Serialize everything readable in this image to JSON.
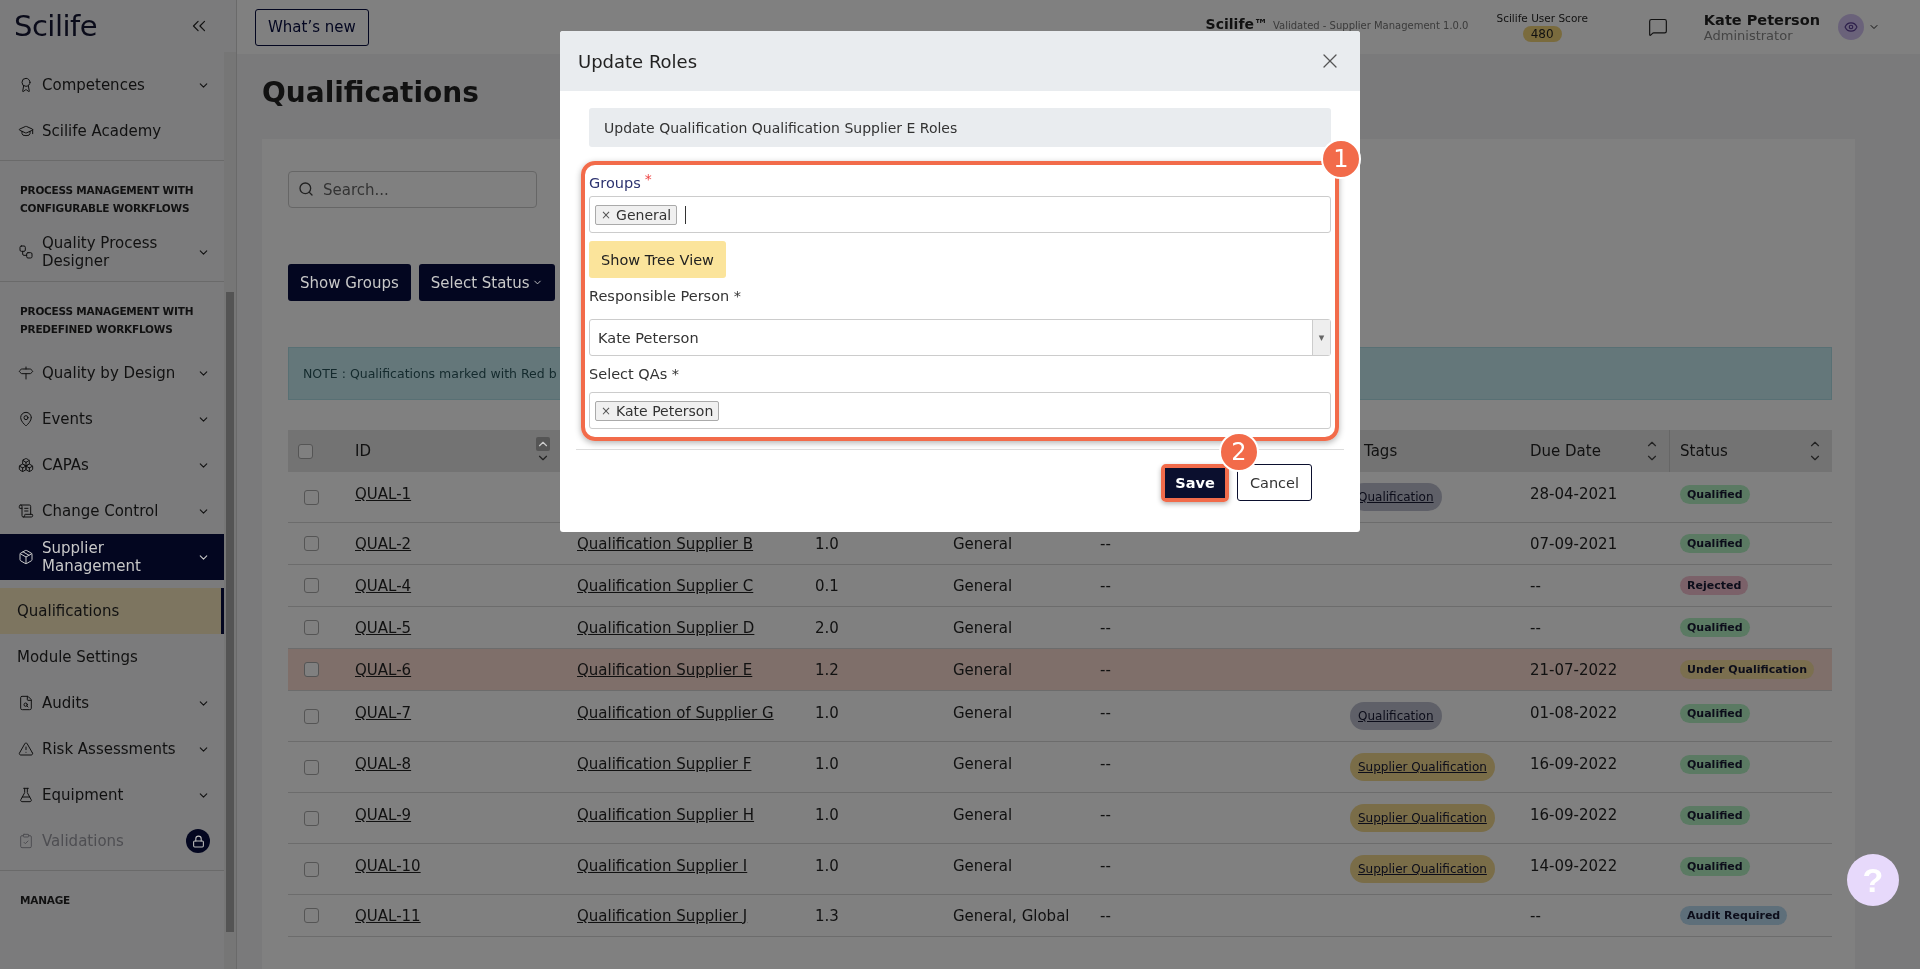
{
  "sidebar": {
    "logo": "Scilife",
    "items": [
      {
        "kind": "nav",
        "label": "Competences",
        "has_submenu": true,
        "selected": false,
        "locked": false
      },
      {
        "kind": "nav",
        "label": "Scilife Academy",
        "has_submenu": false,
        "selected": false,
        "locked": false
      },
      {
        "kind": "section",
        "label": "PROCESS MANAGEMENT WITH CONFIGURABLE WORKFLOWS"
      },
      {
        "kind": "nav",
        "label": "Quality Process Designer",
        "has_submenu": true,
        "selected": false,
        "locked": false
      },
      {
        "kind": "section",
        "label": "PROCESS MANAGEMENT WITH PREDEFINED WORKFLOWS"
      },
      {
        "kind": "nav",
        "label": "Quality by Design",
        "has_submenu": true,
        "selected": false,
        "locked": false
      },
      {
        "kind": "nav",
        "label": "Events",
        "has_submenu": true,
        "selected": false,
        "locked": false
      },
      {
        "kind": "nav",
        "label": "CAPAs",
        "has_submenu": true,
        "selected": false,
        "locked": false
      },
      {
        "kind": "nav",
        "label": "Change Control",
        "has_submenu": true,
        "selected": false,
        "locked": false
      },
      {
        "kind": "nav",
        "label": "Supplier Management",
        "has_submenu": true,
        "selected": true,
        "locked": false
      },
      {
        "kind": "sub",
        "label": "Qualifications",
        "selected": true
      },
      {
        "kind": "sub",
        "label": "Module Settings",
        "selected": false
      },
      {
        "kind": "nav",
        "label": "Audits",
        "has_submenu": true,
        "selected": false,
        "locked": false
      },
      {
        "kind": "nav",
        "label": "Risk Assessments",
        "has_submenu": true,
        "selected": false,
        "locked": false
      },
      {
        "kind": "nav",
        "label": "Equipment",
        "has_submenu": true,
        "selected": false,
        "locked": false
      },
      {
        "kind": "nav",
        "label": "Validations",
        "has_submenu": false,
        "selected": false,
        "locked": true
      },
      {
        "kind": "section",
        "label": "MANAGE"
      }
    ]
  },
  "topbar": {
    "whats_new": "What’s new",
    "app_name": "Scilife™",
    "app_version": "Validated - Supplier Management 1.0.0",
    "score_label": "Scilife User Score",
    "score": "480",
    "user_name": "Kate Peterson",
    "user_role": "Administrator"
  },
  "page": {
    "title": "Qualifications",
    "search": {
      "placeholder": "Search..."
    },
    "buttons": [
      "Show Groups",
      "Select Status"
    ],
    "note": "NOTE : Qualifications marked with Red b"
  },
  "table": {
    "all_checked": false,
    "columns": [
      {
        "label": "ID",
        "sortable": true,
        "sorted": true
      },
      {
        "label": "Tags",
        "sortable": false
      },
      {
        "label": "Due Date",
        "sortable": true,
        "sorted": false
      },
      {
        "label": "Status",
        "sortable": true,
        "sorted": false
      }
    ],
    "rows": [
      {
        "id": "QUAL-1",
        "tag": {
          "label": "Qualification",
          "color": "#5f6068"
        },
        "due": "28-04-2021",
        "status": {
          "label": "Qualified",
          "color": "#5b7a63"
        },
        "checked": false,
        "highlighted": false
      },
      {
        "id": "QUAL-2",
        "name": "Qualification Supplier B",
        "version": "1.0",
        "groups": "General",
        "column_6": "--",
        "due": "07-09-2021",
        "status": {
          "label": "Qualified",
          "color": "#5b7a63"
        },
        "checked": false,
        "highlighted": false
      },
      {
        "id": "QUAL-4",
        "name": "Qualification Supplier C",
        "version": "0.1",
        "groups": "General",
        "column_6": "--",
        "due": "--",
        "status": {
          "label": "Rejected",
          "color": "#7b6169"
        },
        "checked": false,
        "highlighted": false
      },
      {
        "id": "QUAL-5",
        "name": "Qualification Supplier D",
        "version": "2.0",
        "groups": "General",
        "column_6": "--",
        "due": "--",
        "status": {
          "label": "Qualified",
          "color": "#5b7a63"
        },
        "checked": false,
        "highlighted": false
      },
      {
        "id": "QUAL-6",
        "name": "Qualification Supplier E",
        "version": "1.2",
        "groups": "General",
        "column_6": "--",
        "due": "21-07-2022",
        "status": {
          "label": "Under Qualification",
          "color": "#7b6f4f"
        },
        "checked": false,
        "highlighted": true
      },
      {
        "id": "QUAL-7",
        "name": "Qualification of Supplier G",
        "version": "1.0",
        "groups": "General",
        "column_6": "--",
        "tag": {
          "label": "Qualification",
          "color": "#5f6068"
        },
        "due": "01-08-2022",
        "status": {
          "label": "Qualified",
          "color": "#5b7a63"
        },
        "checked": false,
        "highlighted": false
      },
      {
        "id": "QUAL-8",
        "name": "Qualification Supplier F",
        "version": "1.0",
        "groups": "General",
        "column_6": "--",
        "tag": {
          "label": "Supplier Qualification",
          "color": "#7a6d48"
        },
        "due": "16-09-2022",
        "status": {
          "label": "Qualified",
          "color": "#5b7a63"
        },
        "checked": false,
        "highlighted": false
      },
      {
        "id": "QUAL-9",
        "name": "Qualification Supplier H",
        "version": "1.0",
        "groups": "General",
        "column_6": "--",
        "tag": {
          "label": "Supplier Qualification",
          "color": "#7a6d48"
        },
        "due": "16-09-2022",
        "status": {
          "label": "Qualified",
          "color": "#5b7a63"
        },
        "checked": false,
        "highlighted": false
      },
      {
        "id": "QUAL-10",
        "name": "Qualification Supplier I",
        "version": "1.0",
        "groups": "General",
        "column_6": "--",
        "tag": {
          "label": "Supplier Qualification",
          "color": "#7a6d48"
        },
        "due": "14-09-2022",
        "status": {
          "label": "Qualified",
          "color": "#5b7a63"
        },
        "checked": false,
        "highlighted": false
      },
      {
        "id": "QUAL-11",
        "name": "Qualification Supplier J",
        "version": "1.3",
        "groups": "General, Global",
        "column_6": "--",
        "due": "--",
        "status": {
          "label": "Audit Required",
          "color": "#5e6f7a"
        },
        "checked": false,
        "highlighted": false
      }
    ]
  },
  "help_button": "?",
  "modal": {
    "title": "Update Roles",
    "info": "Update Qualification Qualification Supplier E Roles",
    "groups": {
      "label": "Groups",
      "required_mark": "*",
      "chips": [
        {
          "remove": "×",
          "label": "General"
        }
      ]
    },
    "tree_button": "Show Tree View",
    "responsible": {
      "label": "Responsible Person *",
      "value": "Kate Peterson",
      "arrow": "▾"
    },
    "qas": {
      "label": "Select QAs *",
      "chips": [
        {
          "remove": "×",
          "label": "Kate Peterson"
        }
      ]
    },
    "save": "Save",
    "cancel": "Cancel",
    "annotations": [
      "1",
      "2"
    ]
  }
}
